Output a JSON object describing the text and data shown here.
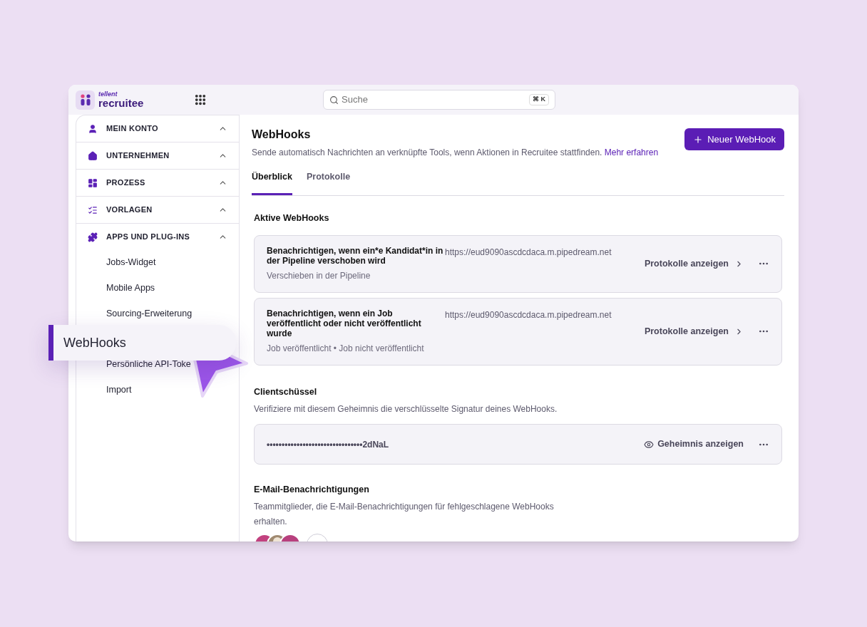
{
  "header": {
    "logo_top": "tellent",
    "logo_bottom": "recruitee",
    "search": {
      "placeholder": "Suche",
      "shortcut": "⌘ K"
    }
  },
  "sidebar": {
    "groups": [
      {
        "label": "MEIN KONTO"
      },
      {
        "label": "UNTERNEHMEN"
      },
      {
        "label": "PROZESS"
      },
      {
        "label": "VORLAGEN"
      },
      {
        "label": "APPS UND PLUG-INS",
        "children": [
          {
            "label": "Jobs-Widget",
            "selected": false
          },
          {
            "label": "Mobile Apps",
            "selected": false
          },
          {
            "label": "Sourcing-Erweiterung",
            "selected": false
          },
          {
            "label": "WebHooks",
            "selected": true
          },
          {
            "label": "Persönliche API-Toke",
            "selected": false
          },
          {
            "label": "Import",
            "selected": false
          }
        ]
      }
    ]
  },
  "main": {
    "title": "WebHooks",
    "subtitle": "Sende automatisch Nachrichten an verknüpfte Tools, wenn Aktionen in Recruitee stattfinden.",
    "link": "Mehr erfahren",
    "new_button": "Neuer WebHook",
    "tabs": [
      {
        "label": "Überblick",
        "selected": true
      },
      {
        "label": "Protokolle",
        "selected": false
      }
    ],
    "active_heading": "Aktive WebHooks",
    "webhooks": [
      {
        "title": "Benachrichtigen, wenn ein*e Kandidat*in in der Pipeline verschoben wird",
        "url": "https://eud9090ascdcdaca.m.pipedream.net",
        "events": "Verschieben in der Pipeline",
        "action": "Protokolle anzeigen"
      },
      {
        "title": "Benachrichtigen, wenn ein Job veröffentlicht oder nicht veröffentlicht wurde",
        "url": "https://eud9090ascdcdaca.m.pipedream.net",
        "events": "Job veröffentlicht • Job nicht veröffentlicht",
        "action": "Protokolle anzeigen"
      }
    ],
    "client_key": {
      "heading": "Clientschüssel",
      "description": "Verifiziere mit diesem Geheimnis die verschlüsselte Signatur deines WebHooks.",
      "secret": "••••••••••••••••••••••••••••••••2dNaL",
      "action": "Geheimnis anzeigen"
    },
    "email": {
      "heading": "E-Mail-Benachrichtigungen",
      "description": "Teammitglieder, die E-Mail-Benachrichtigungen für fehlgeschlagene WebHooks erhalten.",
      "avatars": [
        {
          "kind": "initials",
          "color": "#c2417f"
        },
        {
          "kind": "photo",
          "color": "#a08a70"
        },
        {
          "kind": "initials",
          "color": "#b8407e"
        }
      ]
    }
  }
}
